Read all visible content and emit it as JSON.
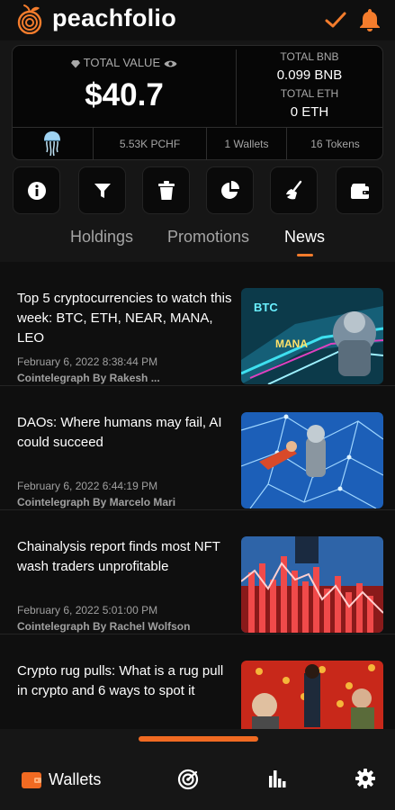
{
  "app": {
    "brand": "peachfolio",
    "accent_color": "#f47c2c",
    "header_icons": [
      "check-icon",
      "bell-icon"
    ]
  },
  "portfolio": {
    "total_value_label": "TOTAL VALUE",
    "total_value": "$40.7",
    "total_bnb_label": "TOTAL BNB",
    "total_bnb": "0.099 BNB",
    "total_eth_label": "TOTAL ETH",
    "total_eth": "0 ETH",
    "stats": {
      "pchf": "5.53K PCHF",
      "wallets": "1 Wallets",
      "tokens": "16 Tokens"
    }
  },
  "toolbar": {
    "buttons": [
      "info-icon",
      "filter-icon",
      "trash-icon",
      "pie-chart-icon",
      "broom-icon",
      "wallet-icon"
    ]
  },
  "tabs": [
    {
      "label": "Holdings",
      "active": false
    },
    {
      "label": "Promotions",
      "active": false
    },
    {
      "label": "News",
      "active": true
    }
  ],
  "news": [
    {
      "title": "Top 5 cryptocurrencies to watch this week: BTC, ETH, NEAR, MANA, LEO",
      "date": "February 6, 2022 8:38:44 PM",
      "source": "Cointelegraph By Rakesh ..."
    },
    {
      "title": "DAOs: Where humans may fail, AI could succeed",
      "date": "February 6, 2022 6:44:19 PM",
      "source": "Cointelegraph By Marcelo Mari"
    },
    {
      "title": "Chainalysis report finds most NFT wash traders unprofitable",
      "date": "February 6, 2022 5:01:00 PM",
      "source": "Cointelegraph By Rachel Wolfson"
    },
    {
      "title": "Crypto rug pulls: What is a rug pull in crypto and 6 ways to spot it",
      "date": "",
      "source": ""
    }
  ],
  "thumb_text": {
    "btc": "BTC",
    "mana": "MANA"
  },
  "bottom_nav": {
    "wallets_label": "Wallets",
    "icons": [
      "wallet-icon",
      "radar-icon",
      "bar-chart-icon",
      "gear-icon"
    ]
  }
}
